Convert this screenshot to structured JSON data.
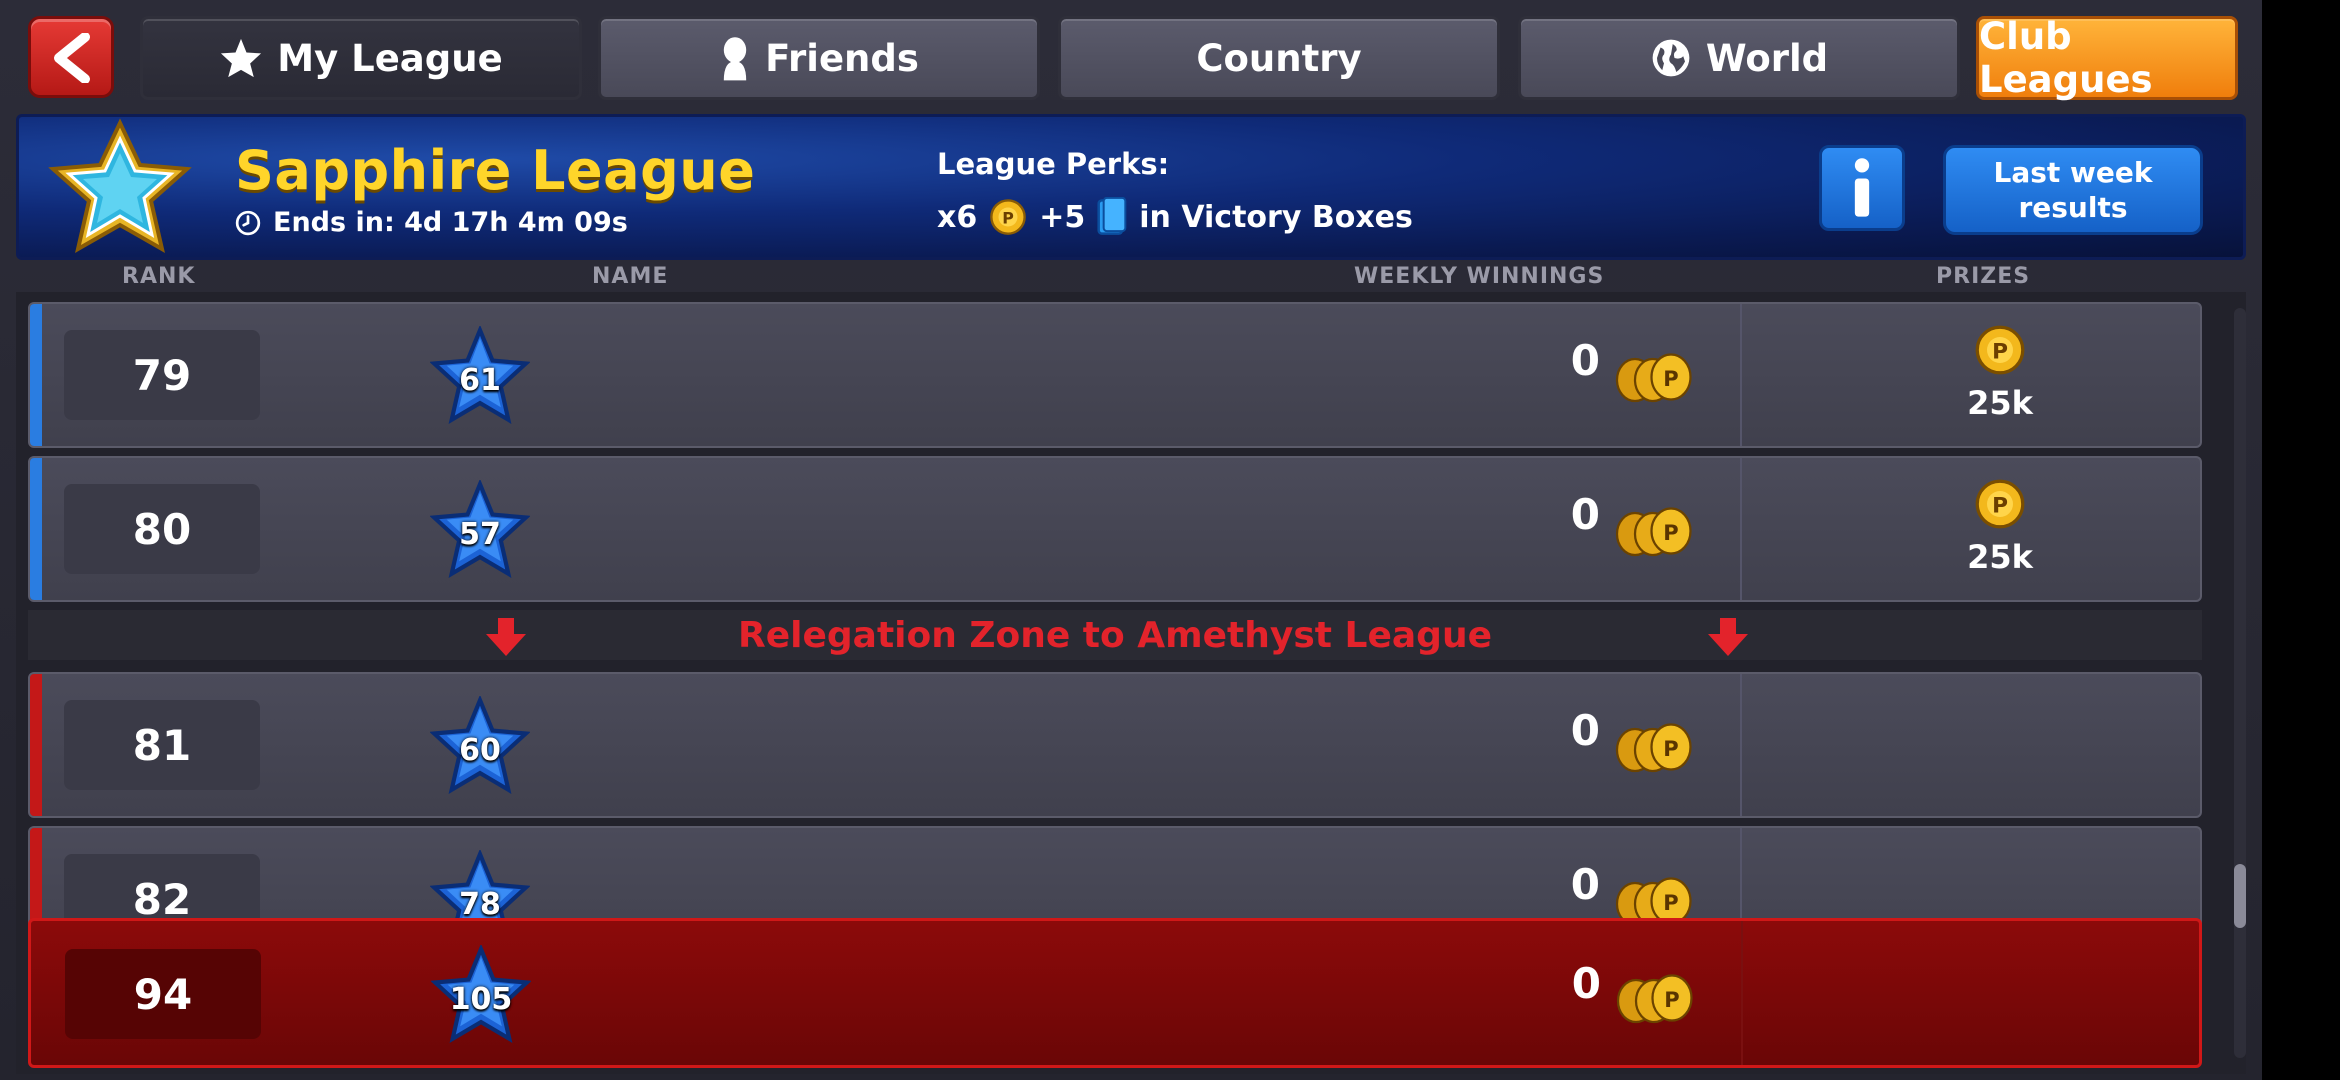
{
  "tabs": {
    "my_league": "My League",
    "friends": "Friends",
    "country": "Country",
    "world": "World",
    "club_leagues": "Club Leagues"
  },
  "banner": {
    "league_name": "Sapphire League",
    "ends_in": "Ends in: 4d 17h 4m 09s",
    "perks_title": "League Perks:",
    "perk_coins": "x6",
    "perk_cards": "+5",
    "perk_suffix": "in Victory Boxes",
    "info_label": "i",
    "last_week_line1": "Last week",
    "last_week_line2": "results"
  },
  "columns": {
    "rank": "RANK",
    "name": "NAME",
    "winnings": "WEEKLY WINNINGS",
    "prizes": "PRIZES"
  },
  "rows": [
    {
      "rank": "79",
      "level": "61",
      "winnings": "0",
      "prize": "25k",
      "zone": "promotion"
    },
    {
      "rank": "80",
      "level": "57",
      "winnings": "0",
      "prize": "25k",
      "zone": "promotion"
    },
    {
      "rank": "81",
      "level": "60",
      "winnings": "0",
      "prize": "",
      "zone": "relegation"
    },
    {
      "rank": "82",
      "level": "78",
      "winnings": "0",
      "prize": "",
      "zone": "relegation"
    }
  ],
  "me_row": {
    "rank": "94",
    "level": "105",
    "winnings": "0"
  },
  "relegation_text": "Relegation Zone to Amethyst League",
  "colors": {
    "gold": "#ffd52a",
    "relegation_red": "#e3232b",
    "stripe_blue": "#2a7de1",
    "stripe_red": "#c41818",
    "club_orange": "#f7931a"
  }
}
